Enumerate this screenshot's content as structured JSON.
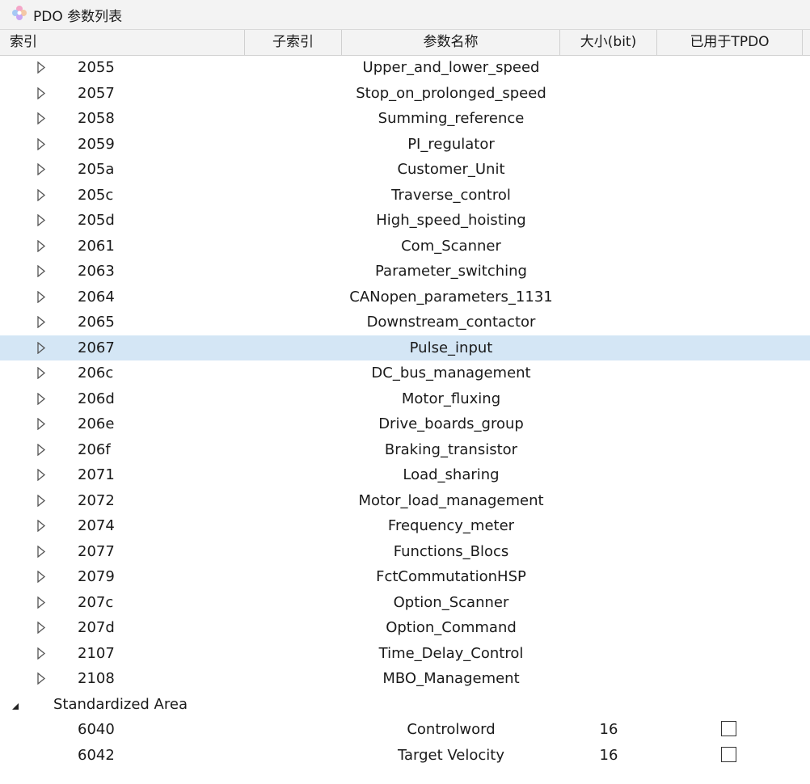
{
  "window": {
    "title": "PDO 参数列表"
  },
  "columns": {
    "index": "索引",
    "subindex": "子索引",
    "param_name": "参数名称",
    "size": "大小(bit)",
    "used_in_tpdo": "已用于TPDO"
  },
  "rows": [
    {
      "index": "2055",
      "name": "Upper_and_lower_speed"
    },
    {
      "index": "2057",
      "name": "Stop_on_prolonged_speed"
    },
    {
      "index": "2058",
      "name": "Summing_reference"
    },
    {
      "index": "2059",
      "name": "PI_regulator"
    },
    {
      "index": "205a",
      "name": "Customer_Unit"
    },
    {
      "index": "205c",
      "name": "Traverse_control"
    },
    {
      "index": "205d",
      "name": "High_speed_hoisting"
    },
    {
      "index": "2061",
      "name": "Com_Scanner"
    },
    {
      "index": "2063",
      "name": "Parameter_switching"
    },
    {
      "index": "2064",
      "name": "CANopen_parameters_1131"
    },
    {
      "index": "2065",
      "name": "Downstream_contactor"
    },
    {
      "index": "2067",
      "name": "Pulse_input"
    },
    {
      "index": "206c",
      "name": "DC_bus_management"
    },
    {
      "index": "206d",
      "name": "Motor_fluxing"
    },
    {
      "index": "206e",
      "name": "Drive_boards_group"
    },
    {
      "index": "206f",
      "name": "Braking_transistor"
    },
    {
      "index": "2071",
      "name": "Load_sharing"
    },
    {
      "index": "2072",
      "name": "Motor_load_management"
    },
    {
      "index": "2074",
      "name": "Frequency_meter"
    },
    {
      "index": "2077",
      "name": "Functions_Blocs"
    },
    {
      "index": "2079",
      "name": "FctCommutationHSP"
    },
    {
      "index": "207c",
      "name": "Option_Scanner"
    },
    {
      "index": "207d",
      "name": "Option_Command"
    },
    {
      "index": "2107",
      "name": "Time_Delay_Control"
    },
    {
      "index": "2108",
      "name": "MBO_Management"
    }
  ],
  "selected_index": "2067",
  "group": {
    "label": "Standardized Area"
  },
  "group_rows": [
    {
      "index": "6040",
      "name": "Controlword",
      "size": "16",
      "used": false
    },
    {
      "index": "6042",
      "name": "Target Velocity",
      "size": "16",
      "used": false
    }
  ],
  "colors": {
    "selected_row": "#d4e6f5",
    "header_bg": "#f3f3f3"
  }
}
